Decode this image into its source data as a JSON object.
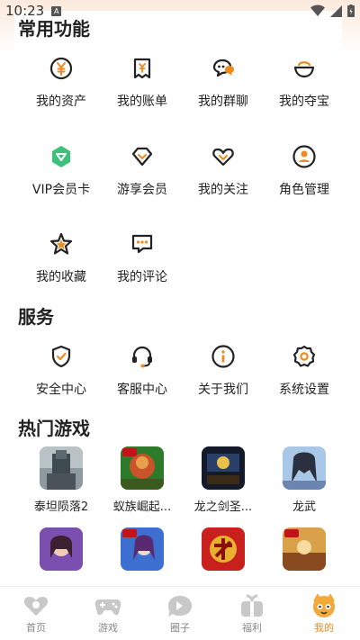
{
  "status": {
    "time": "10:23",
    "notif": "A"
  },
  "colors": {
    "accent": "#f08a1c",
    "green": "#3cc07a"
  },
  "sections": {
    "common": "常用功能",
    "service": "服务",
    "games": "热门游戏"
  },
  "common_items": [
    {
      "label": "我的资产",
      "icon": "yen-coin-icon"
    },
    {
      "label": "我的账单",
      "icon": "bill-icon"
    },
    {
      "label": "我的群聊",
      "icon": "group-chat-icon"
    },
    {
      "label": "我的夺宝",
      "icon": "treasure-icon"
    },
    {
      "label": "VIP会员卡",
      "icon": "vip-card-icon"
    },
    {
      "label": "游享会员",
      "icon": "diamond-icon"
    },
    {
      "label": "我的关注",
      "icon": "heart-icon"
    },
    {
      "label": "角色管理",
      "icon": "user-icon"
    },
    {
      "label": "我的收藏",
      "icon": "star-icon"
    },
    {
      "label": "我的评论",
      "icon": "comment-icon"
    }
  ],
  "service_items": [
    {
      "label": "安全中心",
      "icon": "shield-check-icon"
    },
    {
      "label": "客服中心",
      "icon": "headset-icon"
    },
    {
      "label": "关于我们",
      "icon": "info-icon"
    },
    {
      "label": "系统设置",
      "icon": "gear-icon"
    }
  ],
  "games": [
    {
      "name": "泰坦陨落2"
    },
    {
      "name": "蚁族崛起..."
    },
    {
      "name": "龙之剑圣..."
    },
    {
      "name": "龙武"
    },
    {
      "name": ""
    },
    {
      "name": ""
    },
    {
      "name": ""
    },
    {
      "name": ""
    }
  ],
  "tabs": [
    {
      "label": "首页",
      "icon": "home-icon"
    },
    {
      "label": "游戏",
      "icon": "gamepad-icon"
    },
    {
      "label": "圈子",
      "icon": "circle-icon"
    },
    {
      "label": "福利",
      "icon": "gift-icon"
    },
    {
      "label": "我的",
      "icon": "profile-icon",
      "active": true
    }
  ]
}
